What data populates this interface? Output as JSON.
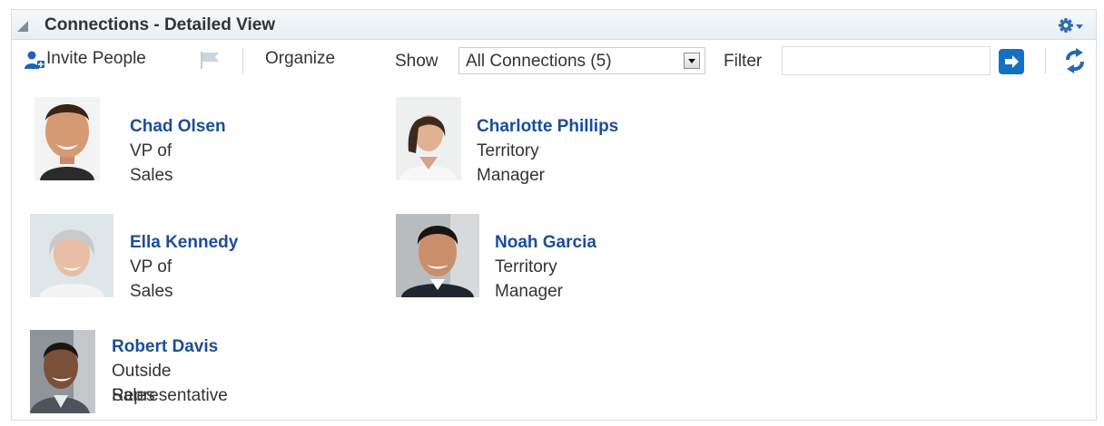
{
  "panel": {
    "title": "Connections - Detailed View"
  },
  "toolbar": {
    "invite_label": "Invite People",
    "organize_label": "Organize",
    "show_label": "Show",
    "show_value": "All Connections (5)",
    "filter_label": "Filter",
    "filter_value": "",
    "filter_placeholder": ""
  },
  "connections": [
    {
      "name": "Chad Olsen",
      "title": "VP of Sales"
    },
    {
      "name": "Charlotte Phillips",
      "title": "Territory Manager"
    },
    {
      "name": "Ella Kennedy",
      "title": "VP of Sales"
    },
    {
      "name": "Noah Garcia",
      "title": "Territory Manager"
    },
    {
      "name": "Robert Davis",
      "title_line1": "Outside Sales",
      "title_line2": "Representative"
    }
  ],
  "icons": {
    "collapse": "collapse-triangle-icon",
    "gear": "gear-icon",
    "invite": "add-person-icon",
    "flag": "flag-icon",
    "dropdown": "chevron-down-icon",
    "go": "arrow-right-icon",
    "refresh": "refresh-icon"
  },
  "colors": {
    "accent": "#1470c4",
    "name_link": "#1a4d9a",
    "header_bg": "#e9f0f5"
  }
}
